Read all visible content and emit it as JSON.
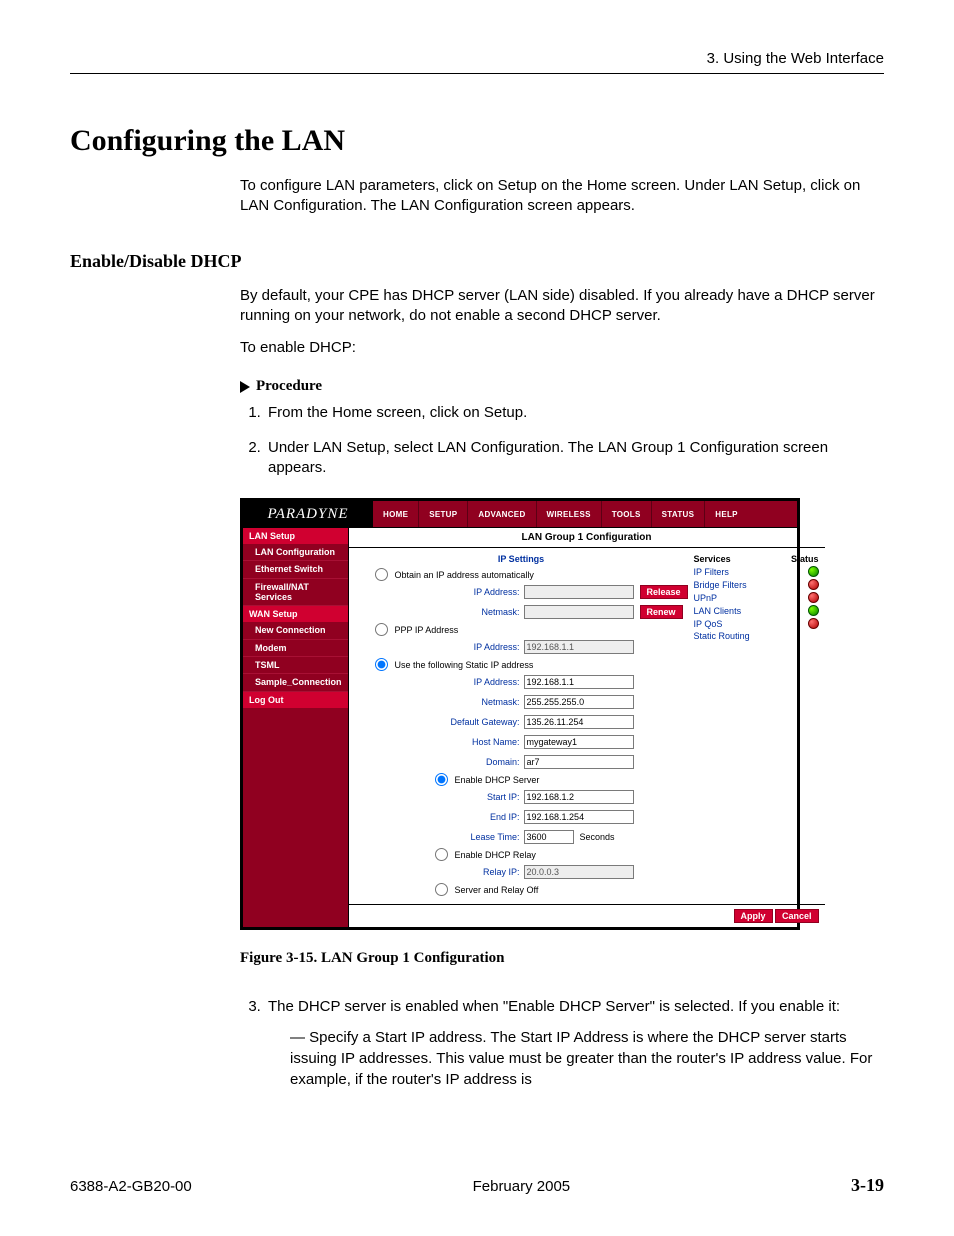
{
  "header": {
    "section": "3. Using the Web Interface"
  },
  "h1": "Configuring the LAN",
  "intro": "To configure LAN parameters, click on Setup on the Home screen. Under LAN Setup, click on LAN Configuration. The LAN Configuration screen appears.",
  "h2": "Enable/Disable DHCP",
  "dhcp_p1": "By default, your CPE has DHCP server (LAN side) disabled. If you already have a DHCP server running on your network, do not enable a second DHCP server.",
  "dhcp_p2": "To enable DHCP:",
  "proc_label": "Procedure",
  "steps": {
    "1": "From the Home screen, click on Setup.",
    "2": "Under LAN Setup, select LAN Configuration. The LAN Group 1 Configuration screen appears.",
    "3": "The DHCP server is enabled when \"Enable DHCP Server\" is selected. If you enable it:",
    "3a": "Specify a Start IP address. The Start IP Address is where the DHCP server starts issuing IP addresses. This value must be greater than the router's IP address value. For example, if the router's IP address is"
  },
  "figcap": "Figure 3-15.   LAN Group 1 Configuration",
  "footer": {
    "doc": "6388-A2-GB20-00",
    "date": "February 2005",
    "page": "3-19"
  },
  "shot": {
    "brand": "PARADYNE",
    "tabs": [
      "HOME",
      "SETUP",
      "ADVANCED",
      "WIRELESS",
      "TOOLS",
      "STATUS",
      "HELP"
    ],
    "sidebar": {
      "group1": "LAN Setup",
      "items1": [
        "LAN Configuration",
        "Ethernet Switch",
        "Firewall/NAT Services"
      ],
      "group2": "WAN Setup",
      "items2": [
        "New Connection",
        "Modem",
        "TSML",
        "Sample_Connection"
      ],
      "group3": "Log Out"
    },
    "title": "LAN Group 1 Configuration",
    "ipsettings_title": "IP Settings",
    "r_obtain": "Obtain an IP address automatically",
    "lbl_ip": "IP Address:",
    "btn_release": "Release",
    "lbl_netmask": "Netmask:",
    "btn_renew": "Renew",
    "r_ppp": "PPP IP Address",
    "lbl_ip_ppp": "IP Address:",
    "val_ip_ppp": "192.168.1.1",
    "r_static": "Use the following Static IP address",
    "lbl_ip_static": "IP Address:",
    "val_ip_static": "192.168.1.1",
    "lbl_nm2": "Netmask:",
    "val_nm2": "255.255.255.0",
    "lbl_gw": "Default Gateway:",
    "val_gw": "135.26.11.254",
    "lbl_host": "Host Name:",
    "val_host": "mygateway1",
    "lbl_domain": "Domain:",
    "val_domain": "ar7",
    "r_dhcpserver": "Enable DHCP Server",
    "lbl_start": "Start IP:",
    "val_start": "192.168.1.2",
    "lbl_end": "End IP:",
    "val_end": "192.168.1.254",
    "lbl_lease": "Lease Time:",
    "val_lease": "3600",
    "lease_unit": "Seconds",
    "r_dhcprelay": "Enable DHCP Relay",
    "lbl_relayip": "Relay IP:",
    "val_relayip": "20.0.0.3",
    "r_off": "Server and Relay Off",
    "btn_apply": "Apply",
    "btn_cancel": "Cancel",
    "svc_head_l": "Services",
    "svc_head_r": "Status",
    "svc": [
      {
        "name": "IP Filters",
        "ok": true
      },
      {
        "name": "Bridge Filters",
        "ok": false
      },
      {
        "name": "UPnP",
        "ok": false
      },
      {
        "name": "LAN Clients",
        "ok": true
      },
      {
        "name": "IP QoS",
        "ok": false
      },
      {
        "name": "Static Routing",
        "ok": null
      }
    ]
  }
}
